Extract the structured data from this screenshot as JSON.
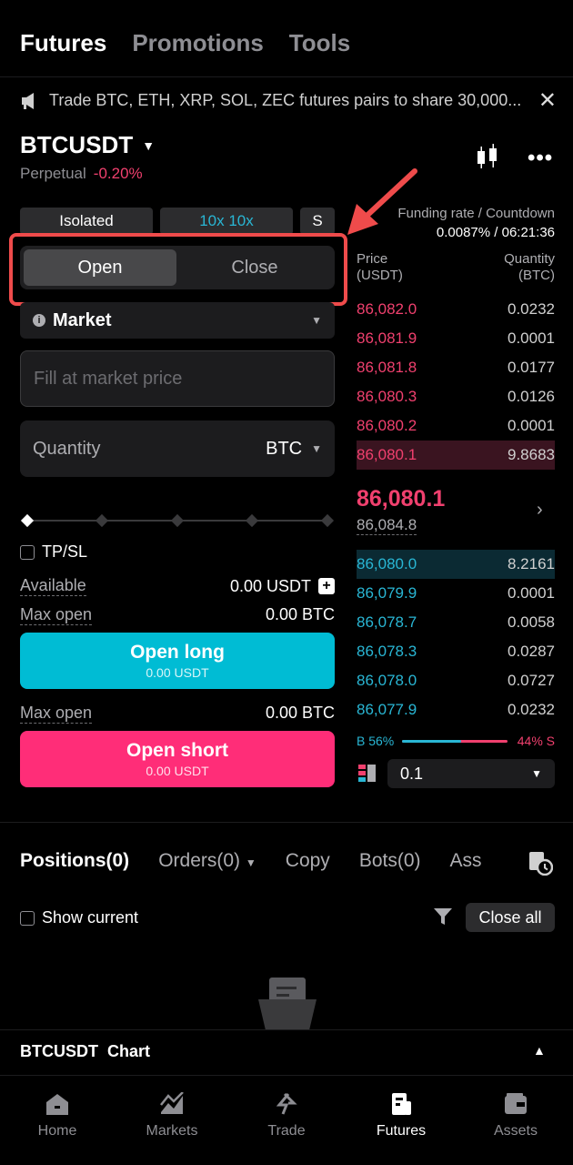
{
  "top_tabs": [
    "Futures",
    "Promotions",
    "Tools"
  ],
  "banner": {
    "text": "Trade BTC, ETH, XRP, SOL, ZEC futures pairs to share 30,000...",
    "close": "✕"
  },
  "symbol": {
    "name": "BTCUSDT",
    "type": "Perpetual",
    "change": "-0.20%"
  },
  "chips": {
    "margin_mode": "Isolated",
    "leverage": "10x 10x",
    "s": "S"
  },
  "funding": {
    "label": "Funding rate / Countdown",
    "value": "0.0087% / 06:21:36"
  },
  "segment": {
    "open": "Open",
    "close": "Close"
  },
  "order_type": "Market",
  "price_placeholder": "Fill at market price",
  "quantity": {
    "label": "Quantity",
    "unit": "BTC"
  },
  "tpsl": "TP/SL",
  "available": {
    "label": "Available",
    "value": "0.00 USDT"
  },
  "max_open_long": {
    "label": "Max open",
    "value": "0.00 BTC"
  },
  "open_long": {
    "label": "Open long",
    "sub": "0.00 USDT"
  },
  "max_open_short": {
    "label": "Max open",
    "value": "0.00 BTC"
  },
  "open_short": {
    "label": "Open short",
    "sub": "0.00 USDT"
  },
  "orderbook": {
    "price_header": "Price\n(USDT)",
    "qty_header": "Quantity\n(BTC)",
    "price_header_1": "Price",
    "price_header_2": "(USDT)",
    "qty_header_1": "Quantity",
    "qty_header_2": "(BTC)",
    "asks": [
      {
        "price": "86,082.0",
        "qty": "0.0232"
      },
      {
        "price": "86,081.9",
        "qty": "0.0001"
      },
      {
        "price": "86,081.8",
        "qty": "0.0177"
      },
      {
        "price": "86,080.3",
        "qty": "0.0126"
      },
      {
        "price": "86,080.2",
        "qty": "0.0001"
      },
      {
        "price": "86,080.1",
        "qty": "9.8683"
      }
    ],
    "last_price": "86,080.1",
    "mark_price": "86,084.8",
    "bids": [
      {
        "price": "86,080.0",
        "qty": "8.2161"
      },
      {
        "price": "86,079.9",
        "qty": "0.0001"
      },
      {
        "price": "86,078.7",
        "qty": "0.0058"
      },
      {
        "price": "86,078.3",
        "qty": "0.0287"
      },
      {
        "price": "86,078.0",
        "qty": "0.0727"
      },
      {
        "price": "86,077.9",
        "qty": "0.0232"
      }
    ],
    "buy_ratio": "B 56%",
    "sell_ratio": "44% S",
    "buy_fraction": 0.56,
    "precision": "0.1"
  },
  "position_tabs": [
    "Positions(0)",
    "Orders(0)",
    "Copy",
    "Bots(0)",
    "Ass"
  ],
  "show_current": "Show current",
  "close_all": "Close all",
  "chart_bar": "BTCUSDT  Chart",
  "nav": [
    "Home",
    "Markets",
    "Trade",
    "Futures",
    "Assets"
  ],
  "colors": {
    "ask": "#f0406e",
    "bid": "#29b6d4",
    "long": "#00bcd4",
    "short": "#ff2d78",
    "highlight": "#ef4b4b"
  }
}
